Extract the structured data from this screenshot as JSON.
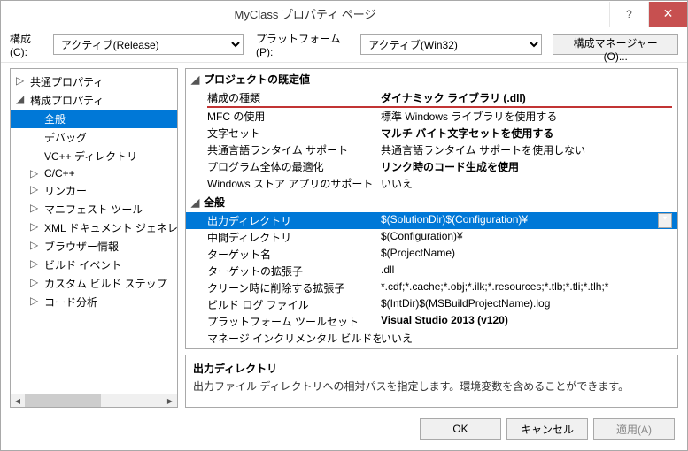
{
  "title": "MyClass プロパティ ページ",
  "toolbar": {
    "config_label": "構成(C):",
    "config_value": "アクティブ(Release)",
    "platform_label": "プラットフォーム(P):",
    "platform_value": "アクティブ(Win32)",
    "config_manager": "構成マネージャー(O)..."
  },
  "tree": [
    {
      "depth": 0,
      "exp": "▷",
      "label": "共通プロパティ",
      "sel": false
    },
    {
      "depth": 0,
      "exp": "◢",
      "label": "構成プロパティ",
      "sel": false
    },
    {
      "depth": 1,
      "exp": "",
      "label": "全般",
      "sel": true
    },
    {
      "depth": 1,
      "exp": "",
      "label": "デバッグ",
      "sel": false
    },
    {
      "depth": 1,
      "exp": "",
      "label": "VC++ ディレクトリ",
      "sel": false
    },
    {
      "depth": 1,
      "exp": "▷",
      "label": "C/C++",
      "sel": false
    },
    {
      "depth": 1,
      "exp": "▷",
      "label": "リンカー",
      "sel": false
    },
    {
      "depth": 1,
      "exp": "▷",
      "label": "マニフェスト ツール",
      "sel": false
    },
    {
      "depth": 1,
      "exp": "▷",
      "label": "XML ドキュメント ジェネレーター",
      "sel": false
    },
    {
      "depth": 1,
      "exp": "▷",
      "label": "ブラウザー情報",
      "sel": false
    },
    {
      "depth": 1,
      "exp": "▷",
      "label": "ビルド イベント",
      "sel": false
    },
    {
      "depth": 1,
      "exp": "▷",
      "label": "カスタム ビルド ステップ",
      "sel": false
    },
    {
      "depth": 1,
      "exp": "▷",
      "label": "コード分析",
      "sel": false
    }
  ],
  "sections": [
    {
      "head": "プロジェクトの既定値",
      "rows": [
        {
          "label": "構成の種類",
          "value": "ダイナミック ライブラリ (.dll)",
          "bold": true,
          "underline": true
        },
        {
          "label": "MFC の使用",
          "value": "標準 Windows ライブラリを使用する"
        },
        {
          "label": "文字セット",
          "value": "マルチ バイト文字セットを使用する",
          "bold": true
        },
        {
          "label": "共通言語ランタイム サポート",
          "value": "共通言語ランタイム サポートを使用しない"
        },
        {
          "label": "プログラム全体の最適化",
          "value": "リンク時のコード生成を使用",
          "bold": true
        },
        {
          "label": "Windows ストア アプリのサポート",
          "value": "いいえ"
        }
      ]
    },
    {
      "head": "全般",
      "rows": [
        {
          "label": "出力ディレクトリ",
          "value": "$(SolutionDir)$(Configuration)¥",
          "highlight": true,
          "dd": true
        },
        {
          "label": "中間ディレクトリ",
          "value": "$(Configuration)¥"
        },
        {
          "label": "ターゲット名",
          "value": "$(ProjectName)"
        },
        {
          "label": "ターゲットの拡張子",
          "value": ".dll"
        },
        {
          "label": "クリーン時に削除する拡張子",
          "value": "*.cdf;*.cache;*.obj;*.ilk;*.resources;*.tlb;*.tli;*.tlh;*"
        },
        {
          "label": "ビルド ログ ファイル",
          "value": "$(IntDir)$(MSBuildProjectName).log"
        },
        {
          "label": "プラットフォーム ツールセット",
          "value": "Visual Studio 2013 (v120)",
          "bold": true
        },
        {
          "label": "マネージ インクリメンタル ビルドを有効にする",
          "value": "いいえ"
        }
      ]
    }
  ],
  "description": {
    "title": "出力ディレクトリ",
    "text": "出力ファイル ディレクトリへの相対パスを指定します。環境変数を含めることができます。"
  },
  "footer": {
    "ok": "OK",
    "cancel": "キャンセル",
    "apply": "適用(A)"
  }
}
